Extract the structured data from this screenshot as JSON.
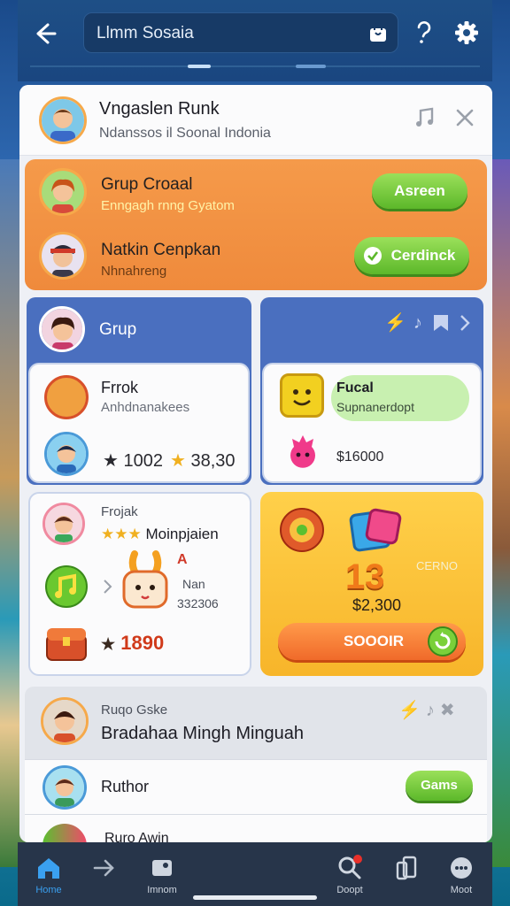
{
  "topbar": {
    "search_text": "Llmm Sosaia"
  },
  "header": {
    "title": "Vngaslen Runk",
    "subtitle": "Ndanssos il Soonal Indonia"
  },
  "orange_card": {
    "item1": {
      "name": "Grup Croaal",
      "sub": "Enngagh rnng Gyatom",
      "button": "Asreen"
    },
    "item2": {
      "name": "Natkin Cenpkan",
      "sub": "Nhnahreng",
      "button": "Cerdinck"
    }
  },
  "grid": {
    "left_top": {
      "header": "Grup",
      "name": "Frrok",
      "sub": "Anhdnanakees",
      "stat1": "1002",
      "stat2": "38,30"
    },
    "right_top": {
      "name": "Fucal",
      "sub": "Supnanerdopt",
      "price": "$16000"
    },
    "left_bottom": {
      "title": "Frojak",
      "name": "Moinpjaien",
      "item_name": "Nan",
      "item_value": "332306",
      "score": "1890",
      "badge": "A"
    },
    "right_bottom": {
      "big_number": "13",
      "price": "$2,300",
      "side_text": "CERNO",
      "button": "SOOOIR"
    }
  },
  "bottom_section": {
    "title": "Ruqo Gske",
    "heading": "Bradahaa Mingh Minguah",
    "row1_label": "Ruthor",
    "row1_button": "Gams",
    "row2_label": "Ruro Awin"
  },
  "nav": {
    "items": [
      {
        "label": "Home"
      },
      {
        "label": ""
      },
      {
        "label": "Imnom"
      },
      {
        "label": "Doopt"
      },
      {
        "label": ""
      },
      {
        "label": "Moot"
      }
    ]
  },
  "colors": {
    "topbar": "#1e4f86",
    "orange_card": "#ef8a3c",
    "blue_card": "#4a6fbf",
    "green_button": "#5cb82a",
    "yellow_card": "#f7b52a"
  }
}
